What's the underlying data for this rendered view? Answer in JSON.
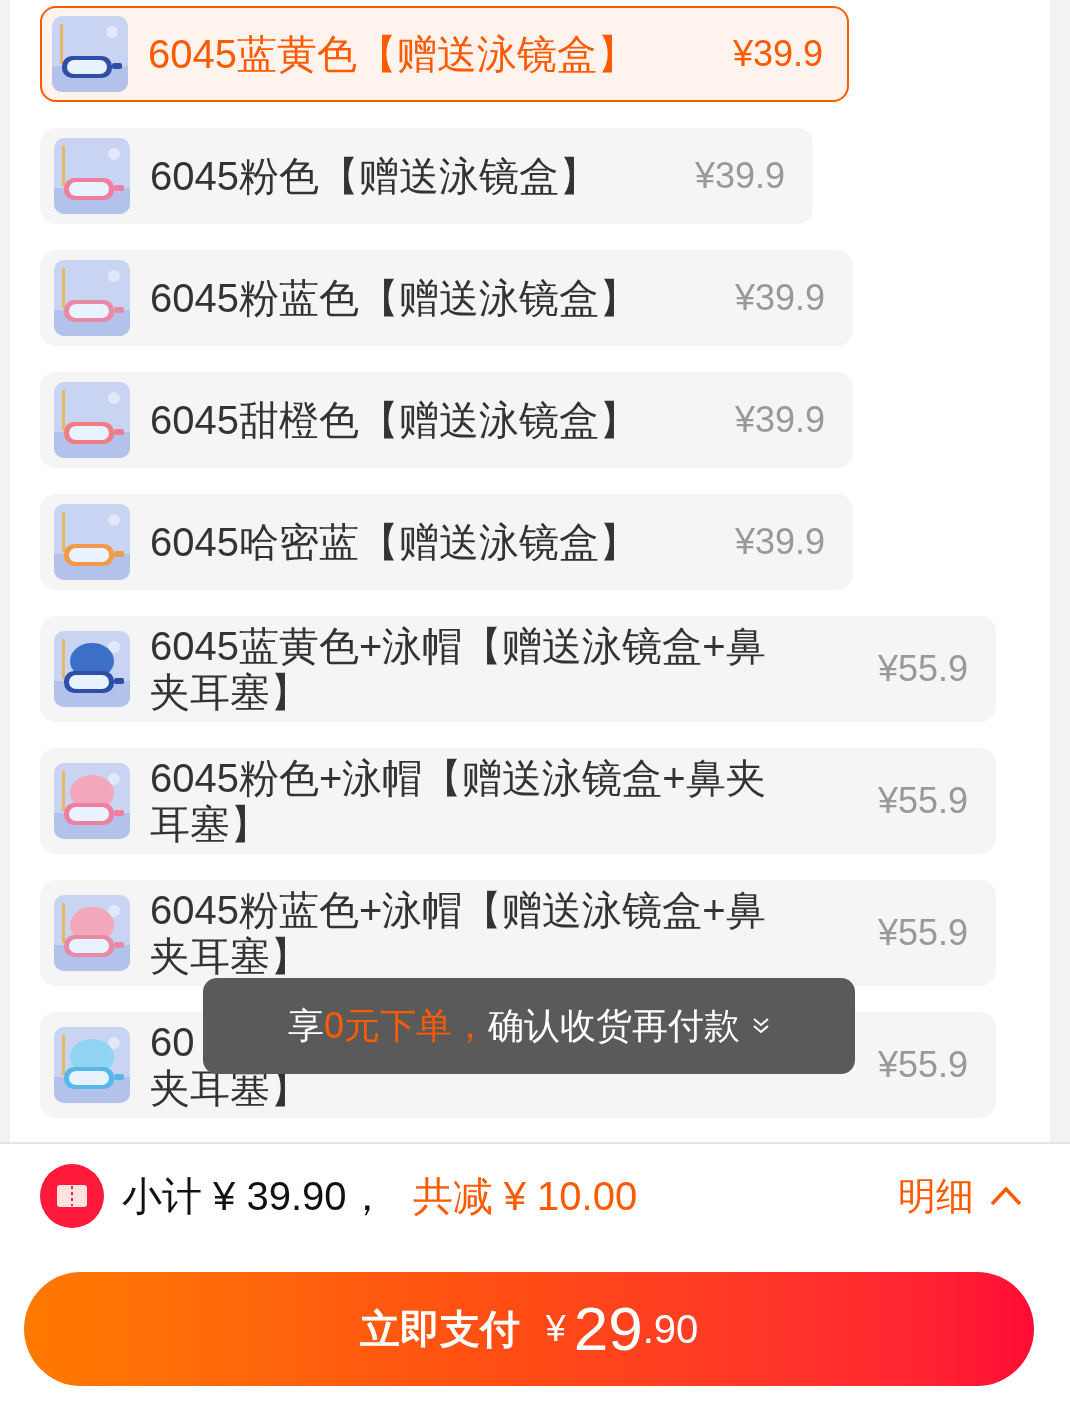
{
  "options": [
    {
      "name": "6045蓝黄色【赠送泳镜盒】",
      "price": "¥39.9",
      "selected": true
    },
    {
      "name": "6045粉色【赠送泳镜盒】",
      "price": "¥39.9",
      "selected": false
    },
    {
      "name": "6045粉蓝色【赠送泳镜盒】",
      "price": "¥39.9",
      "selected": false
    },
    {
      "name": "6045甜橙色【赠送泳镜盒】",
      "price": "¥39.9",
      "selected": false
    },
    {
      "name": "6045哈密蓝【赠送泳镜盒】",
      "price": "¥39.9",
      "selected": false
    },
    {
      "name": "6045蓝黄色+泳帽【赠送泳镜盒+鼻夹耳塞】",
      "price": "¥55.9",
      "selected": false
    },
    {
      "name": "6045粉色+泳帽【赠送泳镜盒+鼻夹耳塞】",
      "price": "¥55.9",
      "selected": false
    },
    {
      "name": "6045粉蓝色+泳帽【赠送泳镜盒+鼻夹耳塞】",
      "price": "¥55.9",
      "selected": false
    },
    {
      "name_lines": [
        "60",
        "夹耳塞】"
      ],
      "price": "¥55.9",
      "selected": false
    }
  ],
  "toast": {
    "segments": [
      {
        "text": "享",
        "highlight": false
      },
      {
        "text": "0元下单，",
        "highlight": true
      },
      {
        "text": "确认收货再付款",
        "highlight": false
      }
    ]
  },
  "summary": {
    "subtotal": "小计 ¥ 39.90，",
    "discount": "共减 ¥ 10.00",
    "details": "明细"
  },
  "pay_button": {
    "label": "立即支付",
    "currency": "¥",
    "amount": "29",
    "decimals": ".90"
  }
}
